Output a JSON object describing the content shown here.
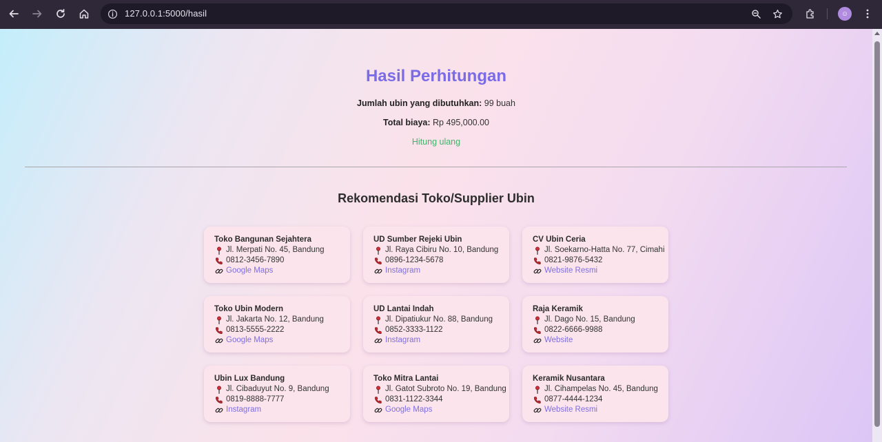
{
  "browser": {
    "url": "127.0.0.1:5000/hasil"
  },
  "page": {
    "title": "Hasil Perhitungan",
    "tiles_label": "Jumlah ubin yang dibutuhkan:",
    "tiles_value": "99 buah",
    "cost_label": "Total biaya:",
    "cost_value": "Rp 495,000.00",
    "recalc_link": "Hitung ulang",
    "recommend_title": "Rekomendasi Toko/Supplier Ubin"
  },
  "stores": [
    {
      "name": "Toko Bangunan Sejahtera",
      "address": "Jl. Merpati No. 45, Bandung",
      "phone": "0812-3456-7890",
      "link": "Google Maps"
    },
    {
      "name": "UD Sumber Rejeki Ubin",
      "address": "Jl. Raya Cibiru No. 10, Bandung",
      "phone": "0896-1234-5678",
      "link": "Instagram"
    },
    {
      "name": "CV Ubin Ceria",
      "address": "Jl. Soekarno-Hatta No. 77, Cimahi",
      "phone": "0821-9876-5432",
      "link": "Website Resmi"
    },
    {
      "name": "Toko Ubin Modern",
      "address": "Jl. Jakarta No. 12, Bandung",
      "phone": "0813-5555-2222",
      "link": "Google Maps"
    },
    {
      "name": "UD Lantai Indah",
      "address": "Jl. Dipatiukur No. 88, Bandung",
      "phone": "0852-3333-1122",
      "link": "Instagram"
    },
    {
      "name": "Raja Keramik",
      "address": "Jl. Dago No. 15, Bandung",
      "phone": "0822-6666-9988",
      "link": "Website"
    },
    {
      "name": "Ubin Lux Bandung",
      "address": "Jl. Cibaduyut No. 9, Bandung",
      "phone": "0819-8888-7777",
      "link": "Instagram"
    },
    {
      "name": "Toko Mitra Lantai",
      "address": "Jl. Gatot Subroto No. 19, Bandung",
      "phone": "0831-1122-3344",
      "link": "Google Maps"
    },
    {
      "name": "Keramik Nusantara",
      "address": "Jl. Cihampelas No. 45, Bandung",
      "phone": "0877-4444-1234",
      "link": "Website Resmi"
    }
  ],
  "icons": {
    "address": "pushpin-icon",
    "phone": "telephone-icon",
    "link": "link-icon"
  },
  "colors": {
    "title": "#7b6ce6",
    "recalc_link": "#3fb36a",
    "store_link": "#7e6ee0",
    "card_bg": "#fbe4ec"
  }
}
